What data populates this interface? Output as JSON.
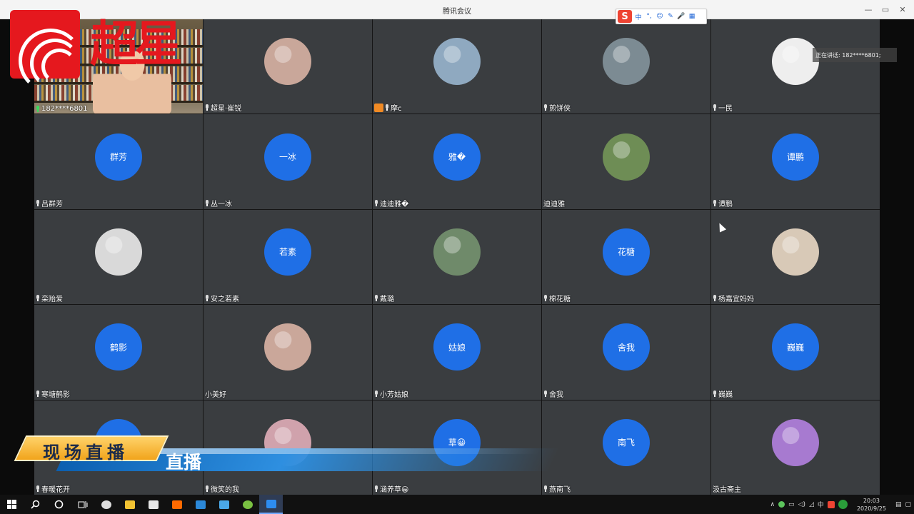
{
  "window": {
    "title": "腾讯会议"
  },
  "window_controls": {
    "minimize": "—",
    "maximize": "▭",
    "close": "✕"
  },
  "ime_toolbar": {
    "logo": "S",
    "items": [
      "中",
      "°,",
      "☺",
      "✎",
      "🎤",
      "▦"
    ]
  },
  "speaking": {
    "label": "正在讲话: 182****6801;"
  },
  "participants": [
    {
      "name": "182****6801",
      "mic": "active",
      "avatar_type": "video"
    },
    {
      "name": "超星·崔锐",
      "mic": "muted",
      "avatar_type": "photo",
      "photo_color": "#c9a79a"
    },
    {
      "name": "摩c",
      "mic": "muted",
      "host": true,
      "avatar_type": "photo",
      "photo_color": "#8fa9c0"
    },
    {
      "name": "煎饼侠",
      "mic": "muted",
      "avatar_type": "photo",
      "photo_color": "#7c8b93"
    },
    {
      "name": "一民",
      "mic": "muted",
      "avatar_type": "photo",
      "photo_color": "#eeeeee"
    },
    {
      "name": "吕群芳",
      "mic": "muted",
      "avatar_type": "text",
      "avatar_text": "群芳"
    },
    {
      "name": "丛一冰",
      "mic": "muted",
      "avatar_type": "text",
      "avatar_text": "一冰"
    },
    {
      "name": "迪迪雅�",
      "mic": "muted",
      "avatar_type": "text",
      "avatar_text": "雅�"
    },
    {
      "name": "迪迪雅",
      "mic": "none",
      "avatar_type": "photo",
      "photo_color": "#6e8d55"
    },
    {
      "name": "谭鹏",
      "mic": "muted",
      "avatar_type": "text",
      "avatar_text": "谭鹏"
    },
    {
      "name": "栾贻爱",
      "mic": "muted",
      "avatar_type": "photo",
      "photo_color": "#d9d9d9"
    },
    {
      "name": "安之若素",
      "mic": "muted",
      "avatar_type": "text",
      "avatar_text": "若素"
    },
    {
      "name": "戴璐",
      "mic": "muted",
      "avatar_type": "photo",
      "photo_color": "#6f8a6a"
    },
    {
      "name": "棉花糖",
      "mic": "muted",
      "avatar_type": "text",
      "avatar_text": "花糖"
    },
    {
      "name": "杨嘉宜妈妈",
      "mic": "muted",
      "avatar_type": "photo",
      "photo_color": "#d8c9b7"
    },
    {
      "name": "寒塘鹤影",
      "mic": "muted",
      "avatar_type": "text",
      "avatar_text": "鹤影"
    },
    {
      "name": "小美好",
      "mic": "none",
      "avatar_type": "photo",
      "photo_color": "#caa79a"
    },
    {
      "name": "小芳姑娘",
      "mic": "muted",
      "avatar_type": "text",
      "avatar_text": "姑娘"
    },
    {
      "name": "舍我",
      "mic": "muted",
      "avatar_type": "text",
      "avatar_text": "舍我"
    },
    {
      "name": "巍巍",
      "mic": "muted",
      "avatar_type": "text",
      "avatar_text": "巍巍"
    },
    {
      "name": "春暖花开",
      "mic": "muted",
      "avatar_type": "text",
      "avatar_text": ""
    },
    {
      "name": "微笑的我",
      "mic": "muted",
      "avatar_type": "photo",
      "photo_color": "#d0a2ac"
    },
    {
      "name": "涵养草😀",
      "mic": "muted",
      "avatar_type": "text",
      "avatar_text": "草😀"
    },
    {
      "name": "燕南飞",
      "mic": "muted",
      "avatar_type": "text",
      "avatar_text": "南飞"
    },
    {
      "name": "汲古斋主",
      "mic": "none",
      "avatar_type": "photo",
      "photo_color": "#a77ad0"
    }
  ],
  "overlay_logo": {
    "chars": "超星",
    "brand_color": "#e5181e"
  },
  "overlay_banner": {
    "tag": "现场直播",
    "text": "直播"
  },
  "taskbar": {
    "icons": [
      "windows-start",
      "search",
      "cortana",
      "task-view",
      "app-1",
      "file-explorer",
      "store",
      "mi",
      "mail",
      "app-blue",
      "app-green",
      "tencent-meeting"
    ],
    "tray": {
      "ime_lang": "中",
      "time": "20:03",
      "date": "2020/9/25"
    }
  },
  "colors": {
    "tile_bg": "#3a3d40",
    "avatar_blue": "#1f6fe6",
    "mic_active": "#3adb5d"
  }
}
